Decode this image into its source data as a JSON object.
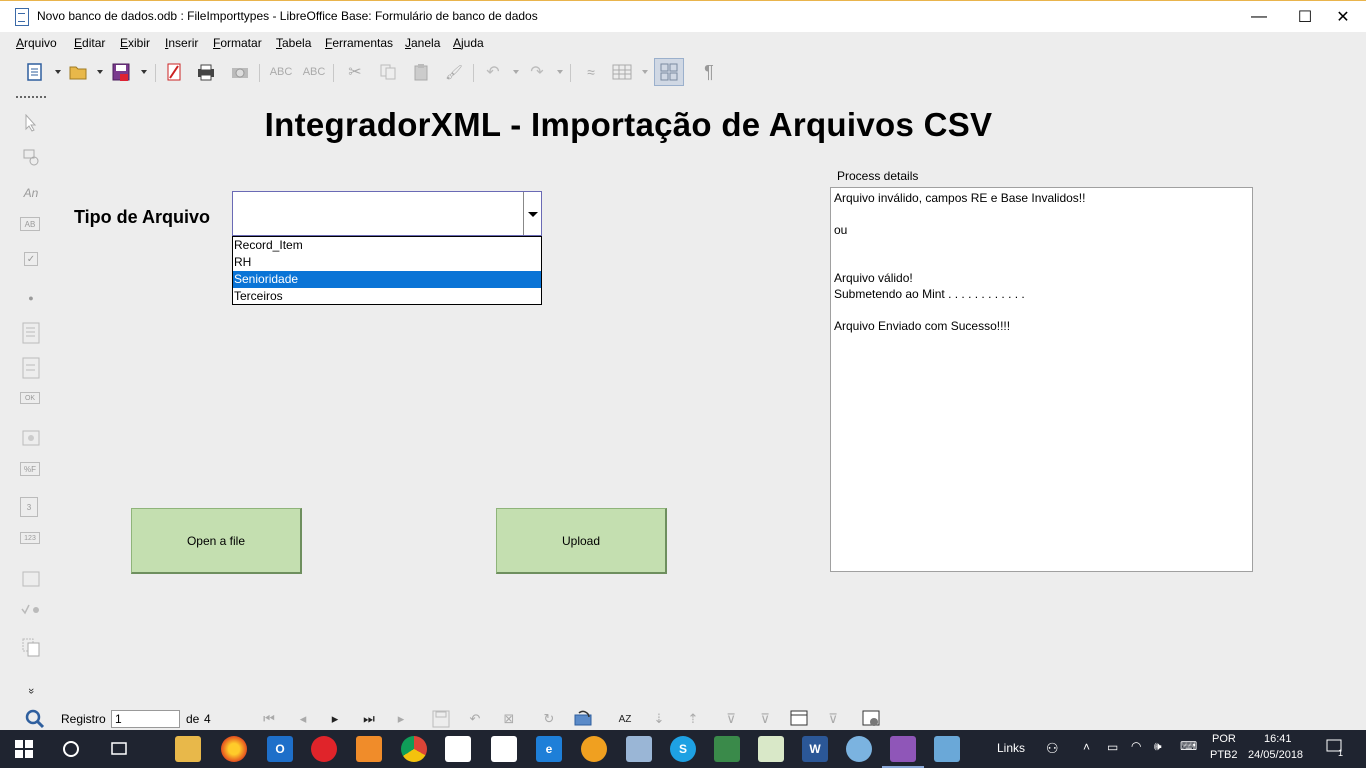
{
  "window": {
    "title": "Novo banco de dados.odb : FileImporttypes - LibreOffice Base: Formulário de banco de dados",
    "minimize_glyph": "—",
    "maximize_glyph": "☐",
    "close_glyph": "✕"
  },
  "menu": {
    "items": [
      {
        "first": "A",
        "rest": "rquivo"
      },
      {
        "first": "E",
        "rest": "ditar"
      },
      {
        "first": "E",
        "rest": "xibir"
      },
      {
        "first": "I",
        "rest": "nserir"
      },
      {
        "first": "F",
        "rest": "ormatar"
      },
      {
        "first": "T",
        "rest": "abela"
      },
      {
        "first": "F",
        "rest": "erramentas"
      },
      {
        "first": "J",
        "rest": "anela"
      },
      {
        "first": "A",
        "rest": "juda"
      }
    ]
  },
  "form": {
    "heading": "IntegradorXML - Importação de Arquivos CSV",
    "tipo_label": "Tipo de Arquivo",
    "combo_value": "",
    "options": [
      "Record_Item",
      "RH",
      "Senioridade",
      "Terceiros"
    ],
    "selected_option": "Senioridade",
    "process_label": "Process details",
    "process_lines": [
      "Arquivo inválido, campos RE e Base Invalidos!!",
      "",
      "ou",
      "",
      "",
      "Arquivo válido!",
      "Submetendo ao Mint . . . . . . . . . . . .",
      "",
      "Arquivo Enviado com  Sucesso!!!!"
    ],
    "open_button": "Open a file",
    "upload_button": "Upload"
  },
  "sidebar_tools": {
    "text_label_glyph": "An",
    "textbox_glyph": "AB",
    "checkbox_glyph": "✓",
    "radio_glyph": "●",
    "push_button_glyph": "OK",
    "formatted_glyph": "%F",
    "date_glyph": "3",
    "numeric_glyph": "123",
    "more_glyph": "»"
  },
  "navigation": {
    "record_label": "Registro",
    "record_value": "1",
    "of_label": "de",
    "total": "4"
  },
  "taskbar": {
    "links_label": "Links",
    "lang_top": "POR",
    "lang_bottom": "PTB2",
    "time": "16:41",
    "date": "24/05/2018",
    "notification_count": "1"
  },
  "colors": {
    "button_green": "#c4dfb0",
    "selection_blue": "#0a74d6",
    "taskbar_bg": "#1f2430"
  }
}
